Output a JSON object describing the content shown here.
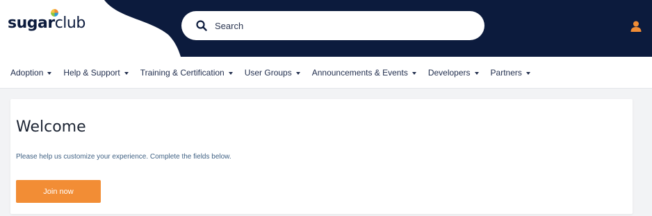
{
  "header": {
    "logo_bold": "sugar",
    "logo_light": "club",
    "search_placeholder": "Search"
  },
  "icons": {
    "search": "search-icon",
    "user": "user-icon",
    "logo_mark": "sugar-dot-icon"
  },
  "nav": {
    "items": [
      {
        "label": "Adoption"
      },
      {
        "label": "Help & Support"
      },
      {
        "label": "Training & Certification"
      },
      {
        "label": "User Groups"
      },
      {
        "label": "Announcements & Events"
      },
      {
        "label": "Developers"
      },
      {
        "label": "Partners"
      }
    ]
  },
  "main": {
    "title": "Welcome",
    "subtitle": "Please help us customize your experience. Complete the fields below.",
    "cta_label": "Join now"
  },
  "colors": {
    "header_navy": "#0c1b3d",
    "accent_orange": "#f28d35",
    "link_blue": "#3d5f82"
  }
}
